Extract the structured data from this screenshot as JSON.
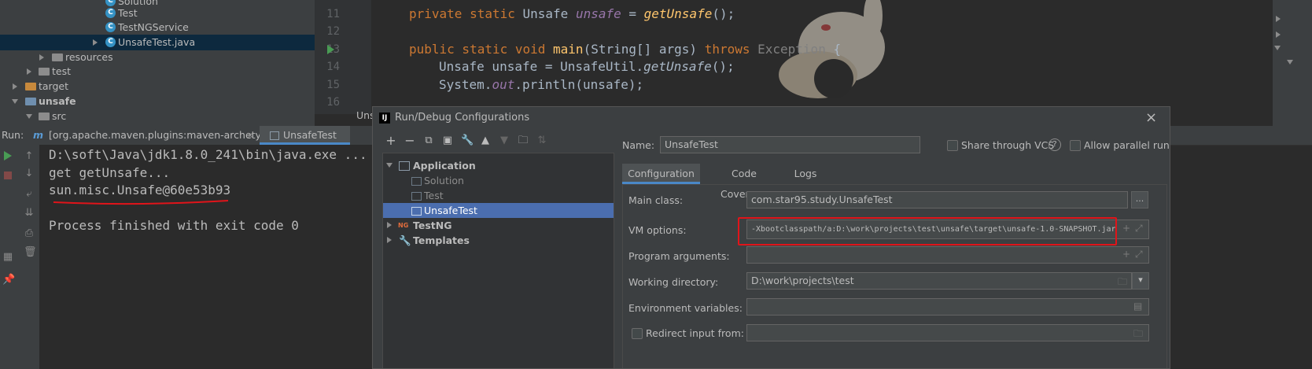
{
  "project_tree": [
    {
      "label": "Solution",
      "type": "class"
    },
    {
      "label": "Test",
      "type": "class"
    },
    {
      "label": "TestNGService",
      "type": "class"
    },
    {
      "label": "UnsafeTest.java",
      "type": "class",
      "selected": true
    },
    {
      "label": "resources",
      "type": "folder"
    },
    {
      "label": "test",
      "type": "folder"
    },
    {
      "label": "target",
      "type": "folder"
    },
    {
      "label": "unsafe",
      "type": "module"
    },
    {
      "label": "src",
      "type": "folder"
    }
  ],
  "editor": {
    "line_numbers": [
      "11",
      "12",
      "13",
      "14",
      "15",
      "16"
    ],
    "line11": {
      "kw1": "private static ",
      "type": "Unsafe ",
      "field": "unsafe",
      "eq": " = ",
      "call": "getUnsafe",
      "tail": "();"
    },
    "line13": {
      "kw1": "public static void ",
      "name": "main",
      "args": "(String[] args) ",
      "throws": "throws ",
      "exc": "Exception",
      "brace": " {"
    },
    "line14": {
      "decl": "Unsafe unsafe = UnsafeUtil.",
      "call": "getUnsafe",
      "tail": "();"
    },
    "line15": {
      "a": "System.",
      "out": "out",
      "b": ".println(unsafe);"
    }
  },
  "run_tabs": {
    "run_label": "Run:",
    "tab1": "[org.apache.maven.plugins:maven-archetyp...",
    "tab1_close": "×",
    "tab2": "UnsafeTest",
    "partial_label": "Uns"
  },
  "console": {
    "lines": [
      "D:\\soft\\Java\\jdk1.8.0_241\\bin\\java.exe ...",
      "get getUnsafe...",
      "sun.misc.Unsafe@60e53b93",
      "Process finished with exit code 0"
    ]
  },
  "dialog": {
    "title": "Run/Debug Configurations",
    "close": "×",
    "logo": "IJ",
    "tree": {
      "application": "Application",
      "items": [
        "Solution",
        "Test",
        "UnsafeTest"
      ],
      "testng": "TestNG",
      "templates": "Templates"
    },
    "name_label": "Name:",
    "name_value": "UnsafeTest",
    "share_vcs": "Share through VCS",
    "help": "?",
    "allow_parallel": "Allow parallel run",
    "tabs": [
      "Configuration",
      "Code Coverage",
      "Logs"
    ],
    "main_class_label": "Main class:",
    "main_class_value": "com.star95.study.UnsafeTest",
    "browse": "...",
    "vm_options_label": "VM options:",
    "vm_options_value": "-Xbootclasspath/a:D:\\work\\projects\\test\\unsafe\\target\\unsafe-1.0-SNAPSHOT.jar",
    "program_args_label": "Program arguments:",
    "working_dir_label": "Working directory:",
    "working_dir_value": "D:\\work\\projects\\test",
    "env_vars_label": "Environment variables:",
    "redirect_label": "Redirect input from:"
  },
  "colors": {
    "highlight_box": "#e0141a",
    "selection": "#4b6eaf",
    "keyword": "#cc7832",
    "field": "#9876aa",
    "method": "#ffc66d"
  }
}
